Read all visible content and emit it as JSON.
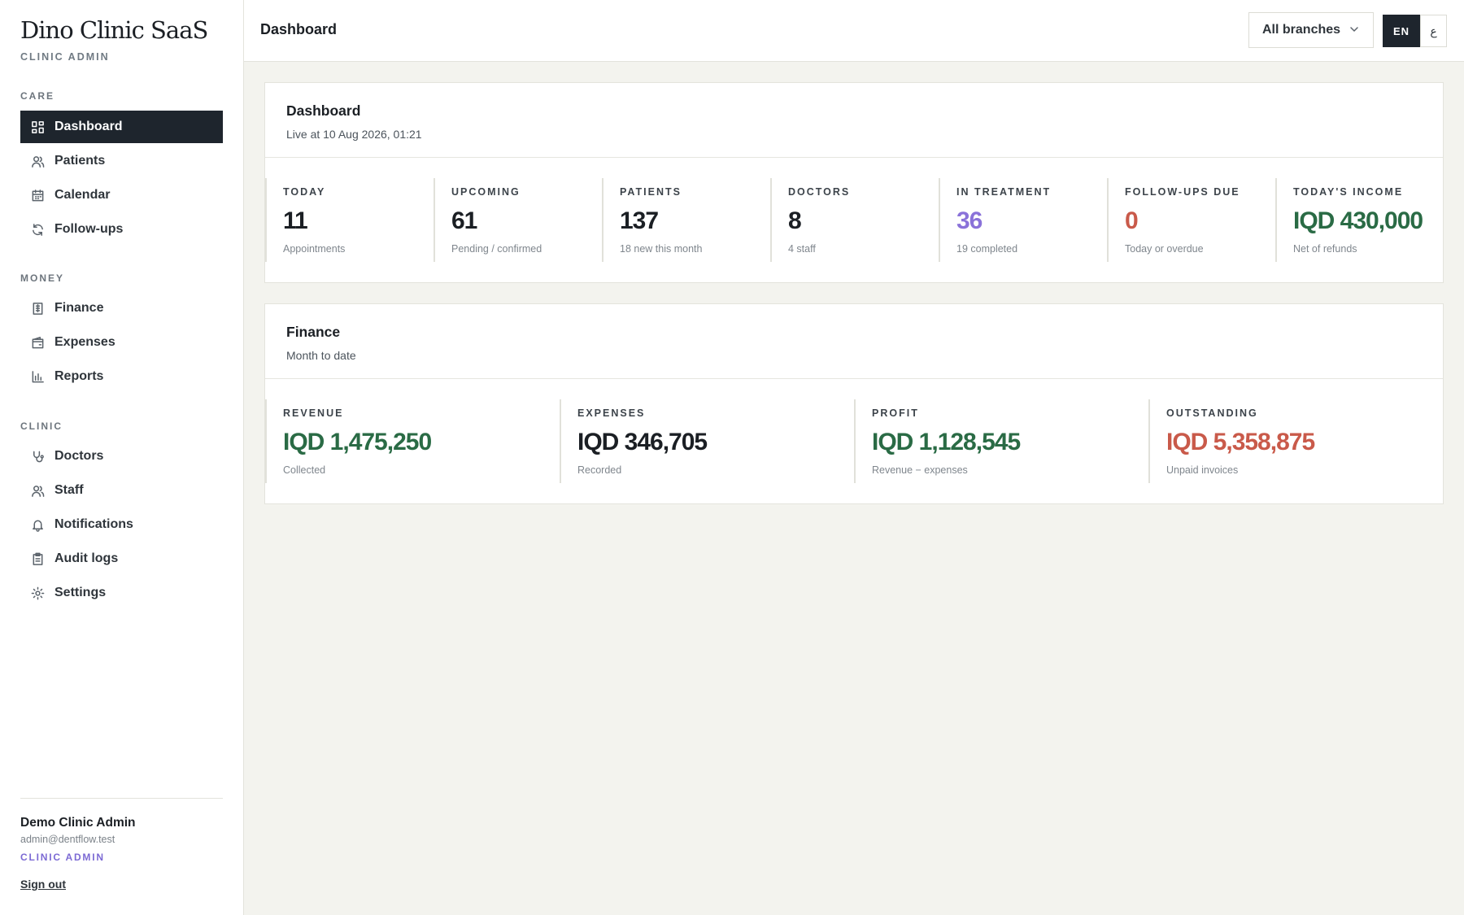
{
  "sidebar": {
    "brand": "Dino Clinic SaaS",
    "brand_subtitle": "CLINIC ADMIN",
    "sections": {
      "care": "CARE",
      "money": "MONEY",
      "clinic": "CLINIC"
    },
    "items": [
      {
        "label": "Dashboard",
        "icon": "grid-icon",
        "active": true
      },
      {
        "label": "Patients",
        "icon": "users-icon"
      },
      {
        "label": "Calendar",
        "icon": "calendar-icon"
      },
      {
        "label": "Follow-ups",
        "icon": "refresh-icon"
      },
      {
        "label": "Finance",
        "icon": "receipt-icon"
      },
      {
        "label": "Expenses",
        "icon": "wallet-icon"
      },
      {
        "label": "Reports",
        "icon": "bar-chart-icon"
      },
      {
        "label": "Doctors",
        "icon": "stethoscope-icon"
      },
      {
        "label": "Staff",
        "icon": "users-icon"
      },
      {
        "label": "Notifications",
        "icon": "bell-icon"
      },
      {
        "label": "Audit logs",
        "icon": "clipboard-icon"
      },
      {
        "label": "Settings",
        "icon": "gear-icon"
      }
    ],
    "user": {
      "name": "Demo Clinic Admin",
      "email": "admin@dentflow.test",
      "role": "CLINIC ADMIN",
      "sign_out": "Sign out"
    }
  },
  "topbar": {
    "title": "Dashboard",
    "branch_select": "All branches",
    "lang_en": "EN",
    "lang_ar": "ع"
  },
  "dashboard_card": {
    "title": "Dashboard",
    "subtitle": "Live at 10 Aug 2026, 01:21",
    "stats": [
      {
        "label": "TODAY",
        "value": "11",
        "note": "Appointments"
      },
      {
        "label": "UPCOMING",
        "value": "61",
        "note": "Pending / confirmed"
      },
      {
        "label": "PATIENTS",
        "value": "137",
        "note": "18 new this month"
      },
      {
        "label": "DOCTORS",
        "value": "8",
        "note": "4 staff"
      },
      {
        "label": "IN TREATMENT",
        "value": "36",
        "note": "19 completed"
      },
      {
        "label": "FOLLOW-UPS DUE",
        "value": "0",
        "note": "Today or overdue"
      },
      {
        "label": "TODAY'S INCOME",
        "value": "IQD 430,000",
        "note": "Net of refunds"
      }
    ]
  },
  "finance_card": {
    "title": "Finance",
    "subtitle": "Month to date",
    "stats": [
      {
        "label": "REVENUE",
        "value": "IQD 1,475,250",
        "note": "Collected"
      },
      {
        "label": "EXPENSES",
        "value": "IQD 346,705",
        "note": "Recorded"
      },
      {
        "label": "PROFIT",
        "value": "IQD 1,128,545",
        "note": "Revenue − expenses"
      },
      {
        "label": "OUTSTANDING",
        "value": "IQD 5,358,875",
        "note": "Unpaid invoices"
      }
    ]
  },
  "colors": {
    "dark": "#1e252d",
    "green": "#2a6b45",
    "purple": "#8a72d9",
    "red": "#c95a4a",
    "text": "#1b1f24",
    "accent_role": "#7c6ad4"
  }
}
